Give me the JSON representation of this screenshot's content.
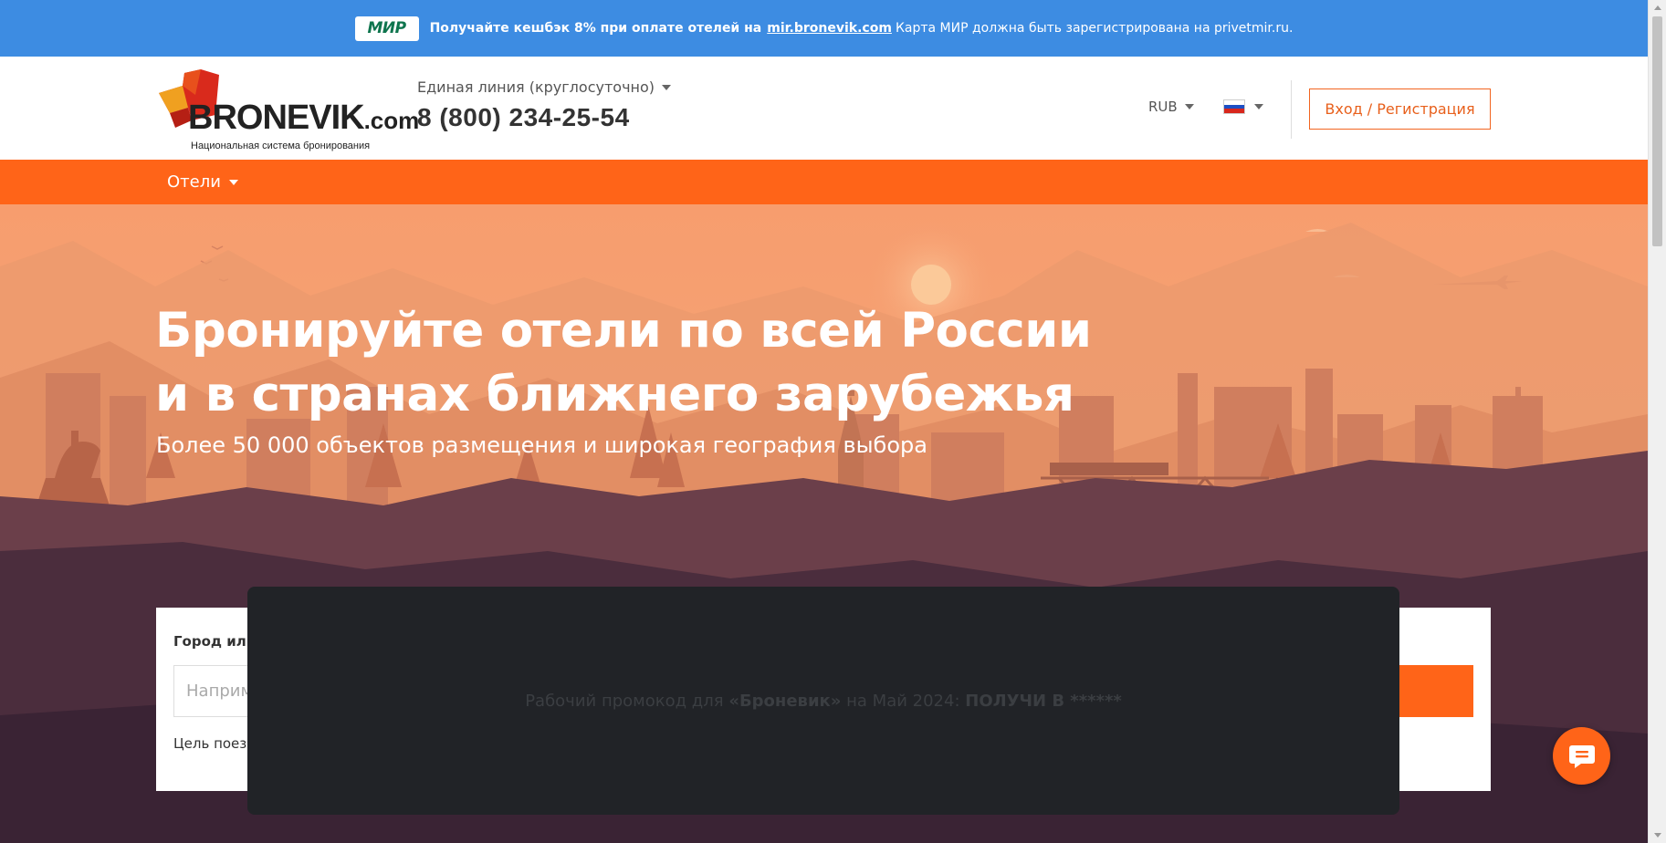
{
  "promo_bar": {
    "mir_logo_text": "МИР",
    "text": "Получайте кешбэк 8% при оплате отелей на",
    "link": "mir.bronevik.com",
    "rest": "Карта МИР должна быть зарегистрирована на privetmir.ru."
  },
  "header": {
    "logo_word": "BRONEVIK",
    "logo_suffix": ".com",
    "logo_tagline": "Национальная система бронирования",
    "hotline_label": "Единая линия (круглосуточно)",
    "phone": "8 (800) 234-25-54",
    "currency": "RUB",
    "language_icon": "ru-flag-icon",
    "login_label": "Вход / Регистрация"
  },
  "nav": {
    "items": [
      {
        "label": "Отели"
      }
    ]
  },
  "hero": {
    "title_line1": "Бронируйте отели по всей России",
    "title_line2": "и в странах ближнего зарубежья",
    "subtitle": "Более 50 000 объектов размещения и широкая география выбора"
  },
  "search": {
    "label": "Город или",
    "input_placeholder": "Наприм",
    "purpose_label": "Цель поезд"
  },
  "popup": {
    "text_prefix": "Рабочий промокод для",
    "brand": "«Броневик»",
    "text_middle": "на Май 2024:",
    "code": "ПОЛУЧИ В ******"
  },
  "colors": {
    "promo_bar": "#3d8ce2",
    "accent": "#ff6418",
    "popup": "#212327"
  }
}
